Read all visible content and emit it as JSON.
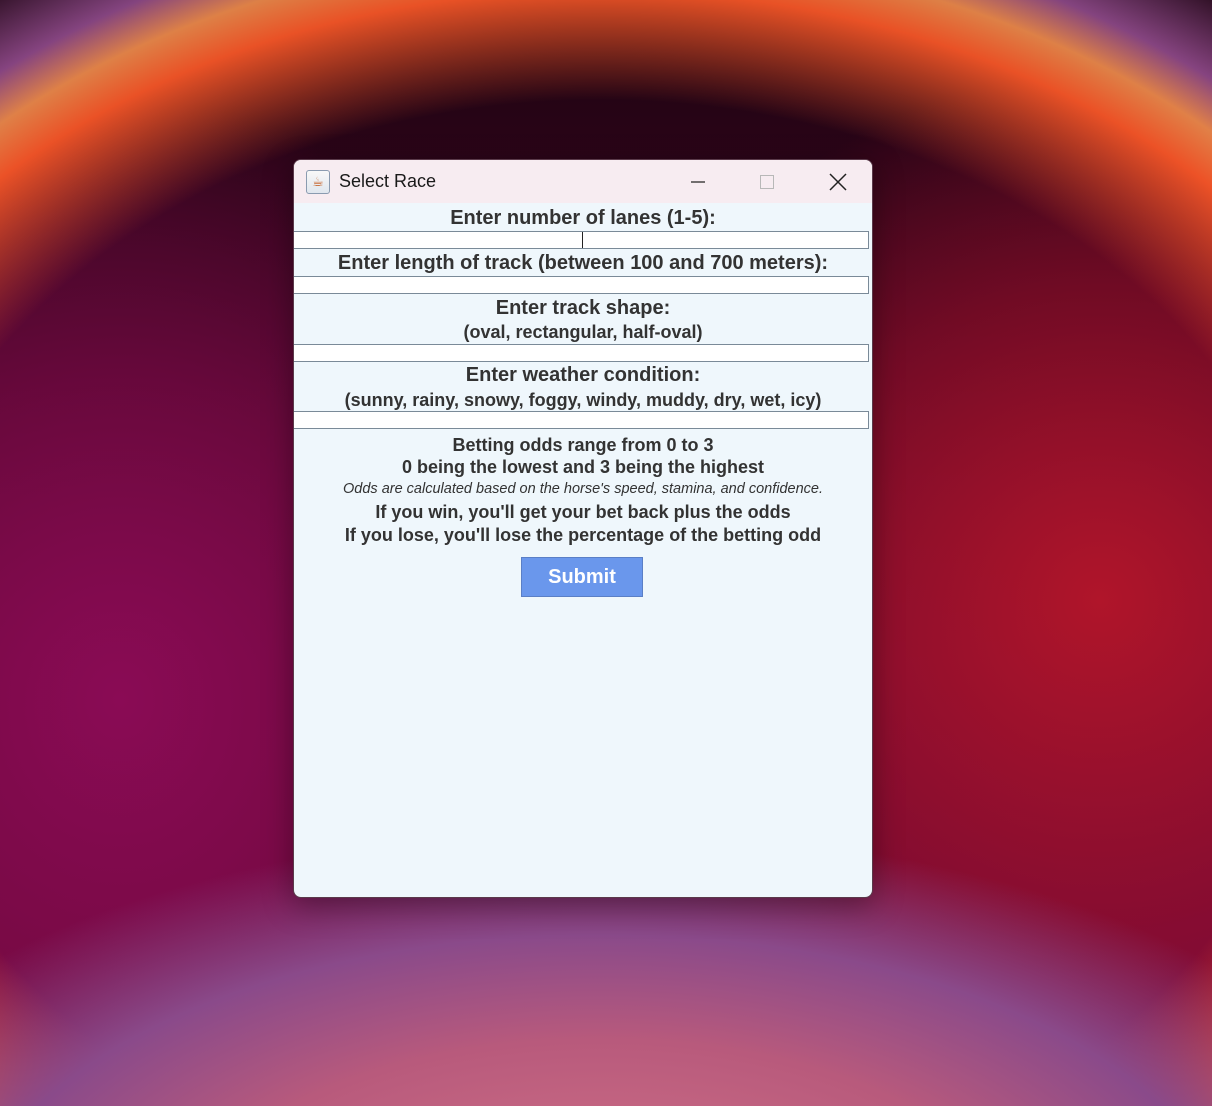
{
  "window": {
    "title": "Select Race",
    "icon": "java-cup-icon"
  },
  "form": {
    "lanes_label": "Enter number of lanes (1-5):",
    "lanes_value": "",
    "length_label": "Enter length of track (between 100 and 700 meters):",
    "length_value": "",
    "shape_label": "Enter track shape:",
    "shape_options": "(oval, rectangular, half-oval)",
    "shape_value": "",
    "weather_label": "Enter weather condition:",
    "weather_options": "(sunny, rainy, snowy, foggy, windy, muddy, dry, wet, icy)",
    "weather_value": ""
  },
  "info": {
    "odds_range": "Betting odds range from 0 to 3",
    "odds_scale": "0 being the lowest and 3 being the highest",
    "odds_calc": "Odds are calculated based on the horse's speed, stamina, and confidence.",
    "win_rule": "If you win, you'll get your bet back plus the odds",
    "lose_rule": "If you lose, you'll lose the percentage of the betting odd"
  },
  "actions": {
    "submit_label": "Submit"
  },
  "colors": {
    "window_bg": "#eff7fc",
    "titlebar_bg": "#f7ecf1",
    "submit_bg": "#6a97ec",
    "text": "#333333"
  }
}
